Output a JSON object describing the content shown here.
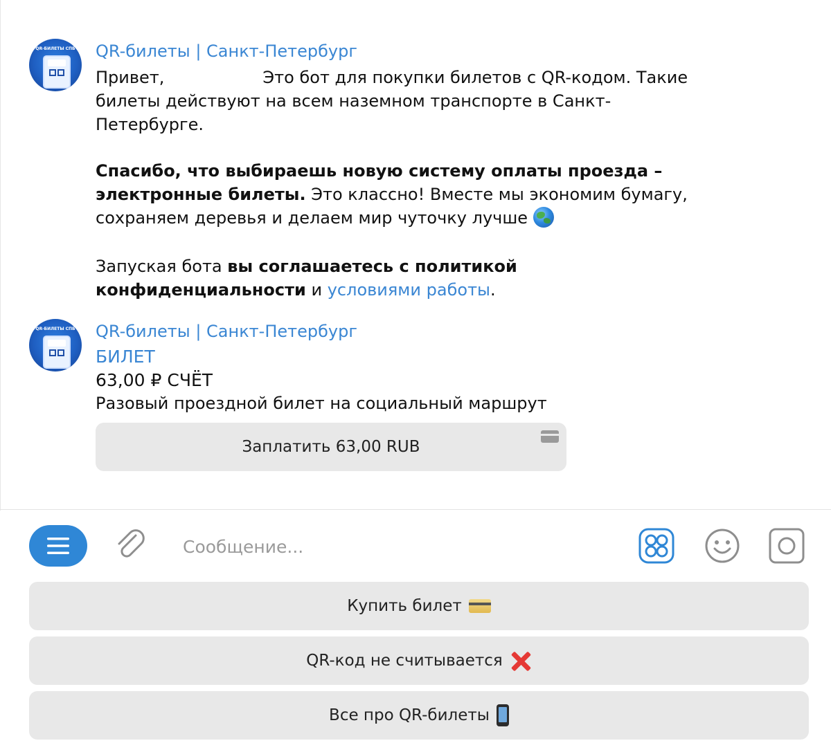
{
  "messages": [
    {
      "sender": "QR-билеты | Санкт-Петербург",
      "avatar_text": "QR-БИЛЕТЫ СПБ",
      "p1": {
        "a": "Привет,",
        "b": "Это бот для покупки билетов с QR-кодом. Такие билеты действуют на всем наземном транспорте в Санкт-Петербурге."
      },
      "p2": {
        "bold": "Спасибо, что выбираешь новую систему оплаты проезда – электронные билеты.",
        "rest": "Это классно! Вместе мы экономим бумагу, сохраняем деревья и делаем мир чуточку лучше"
      },
      "p3": {
        "a": "Запуская бота",
        "bold": "вы соглашаетесь с политикой конфиденциальности",
        "and": "и",
        "link": "условиями работы",
        "end": "."
      }
    },
    {
      "sender": "QR-билеты | Санкт-Петербург",
      "avatar_text": "QR-БИЛЕТЫ СПБ",
      "invoice": {
        "title": "БИЛЕТ",
        "amount": "63,00 ₽ СЧЁТ",
        "description": "Разовый проездной билет на социальный маршрут",
        "pay_label": "Заплатить 63,00 RUB"
      }
    }
  ],
  "input": {
    "placeholder": "Сообщение..."
  },
  "keyboard": [
    {
      "label": "Купить билет",
      "emoji": "credit-card"
    },
    {
      "label": "QR-код не считывается",
      "emoji": "cross-mark"
    },
    {
      "label": "Все про QR-билеты",
      "emoji": "mobile-phone"
    }
  ],
  "colors": {
    "accent": "#3a86d3",
    "menu_button": "#2f87d6",
    "button_bg": "#e8e8e8"
  }
}
